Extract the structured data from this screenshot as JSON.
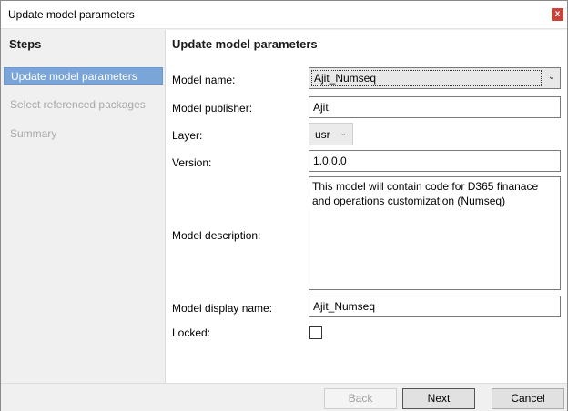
{
  "window": {
    "title": "Update model parameters",
    "close_label": "x"
  },
  "sidebar": {
    "heading": "Steps",
    "items": [
      {
        "label": "Update model parameters",
        "state": "active"
      },
      {
        "label": "Select referenced packages",
        "state": "disabled"
      },
      {
        "label": "Summary",
        "state": "disabled"
      }
    ]
  },
  "main": {
    "heading": "Update model parameters",
    "fields": {
      "model_name": {
        "label": "Model name:",
        "value": "Ajit_Numseq"
      },
      "model_publisher": {
        "label": "Model publisher:",
        "value": "Ajit"
      },
      "layer": {
        "label": "Layer:",
        "value": "usr"
      },
      "version": {
        "label": "Version:",
        "value": "1.0.0.0"
      },
      "model_description": {
        "label": "Model description:",
        "value": "This model will contain code for D365 finanace and operations customization (Numseq)"
      },
      "model_display_name": {
        "label": "Model display name:",
        "value": "Ajit_Numseq"
      },
      "locked": {
        "label": "Locked:",
        "checked": false
      }
    }
  },
  "footer": {
    "back_label": "Back",
    "next_label": "Next",
    "cancel_label": "Cancel"
  },
  "colors": {
    "active_step": "#7aa5d8",
    "close_button": "#c8443a"
  },
  "icons": {
    "close": "close-icon",
    "dropdown": "chevron-down-icon"
  }
}
